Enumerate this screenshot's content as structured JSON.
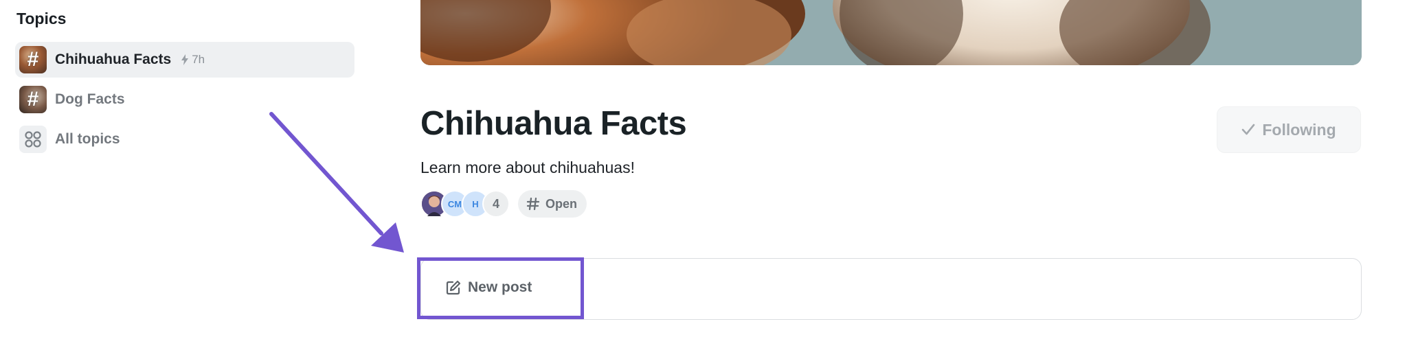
{
  "sidebar": {
    "title": "Topics",
    "items": [
      {
        "label": "Chihuahua Facts",
        "badge": "7h",
        "icon": "hash-icon",
        "active": true
      },
      {
        "label": "Dog Facts",
        "icon": "hash-icon",
        "active": false
      },
      {
        "label": "All topics",
        "icon": "grid-icon",
        "active": false
      }
    ]
  },
  "topic": {
    "title": "Chihuahua Facts",
    "description": "Learn more about chihuahuas!",
    "follow_label": "Following",
    "members": {
      "avatars": [
        "CM",
        "H"
      ],
      "count": "4"
    },
    "visibility": "Open"
  },
  "composer": {
    "new_post_label": "New post"
  },
  "annotation": {
    "color": "#7256d0"
  }
}
